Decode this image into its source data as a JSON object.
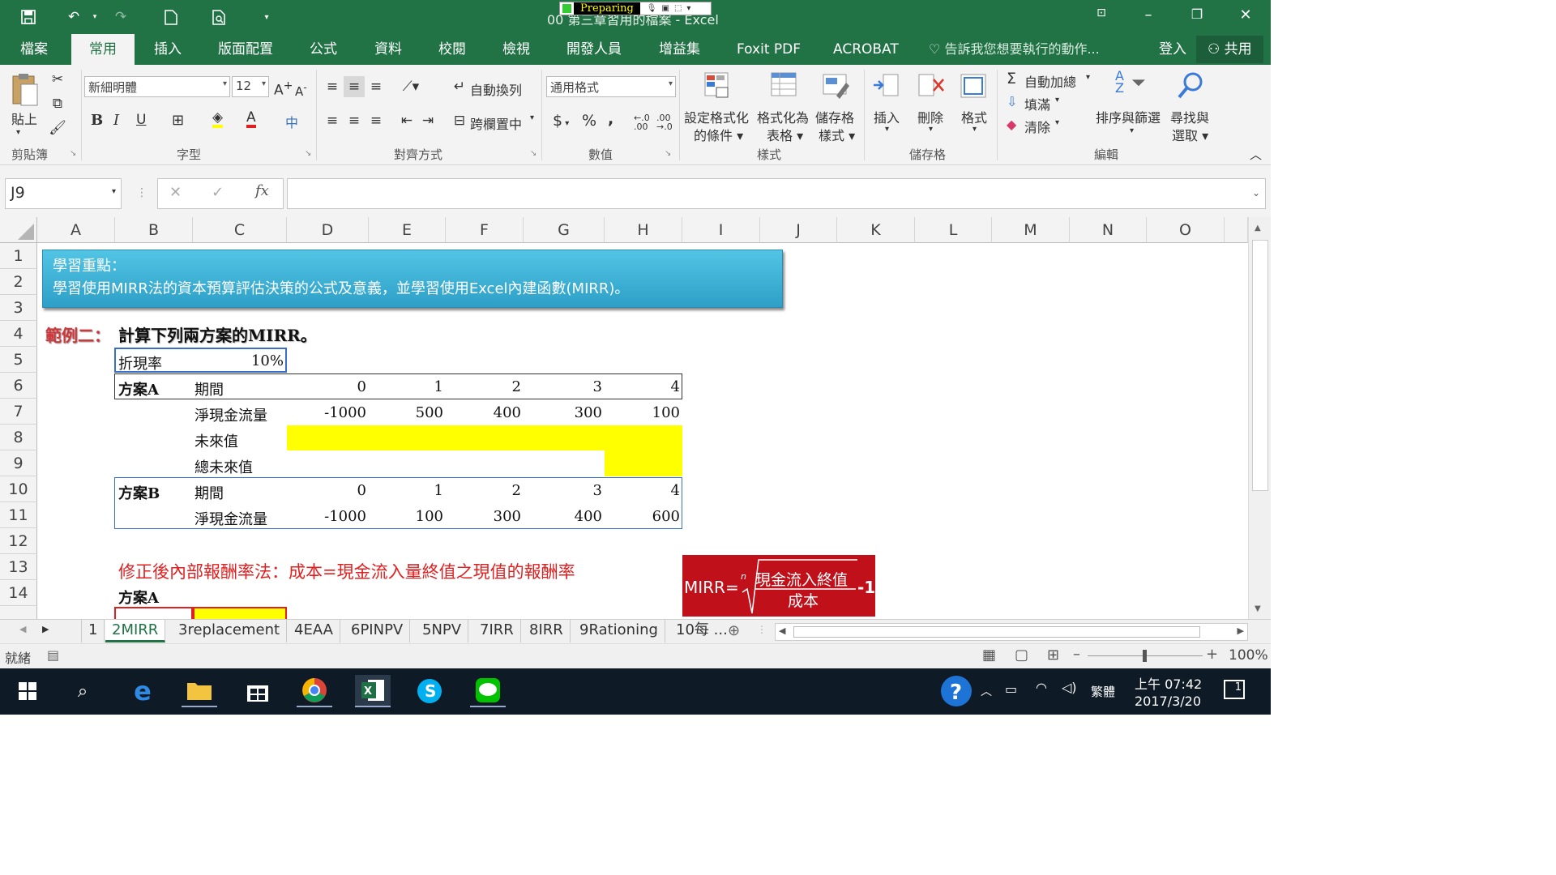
{
  "window": {
    "title": "00 第三章習用的檔案 - Excel",
    "recorder_label": "Preparing"
  },
  "tabs": [
    "檔案",
    "常用",
    "插入",
    "版面配置",
    "公式",
    "資料",
    "校閱",
    "檢視",
    "開發人員",
    "增益集",
    "Foxit PDF",
    "ACROBAT"
  ],
  "active_tab": "常用",
  "tell_me": "告訴我您想要執行的動作...",
  "signin": "登入",
  "share": "共用",
  "ribbon": {
    "clipboard": {
      "paste": "貼上",
      "label": "剪貼簿"
    },
    "font": {
      "name": "新細明體",
      "size": "12",
      "label": "字型"
    },
    "alignment": {
      "wrap": "自動換列",
      "merge": "跨欄置中",
      "label": "對齊方式"
    },
    "number": {
      "format": "通用格式",
      "label": "數值",
      "currency": "$",
      "percent": "%",
      "comma": ","
    },
    "styles": {
      "conditional": "設定格式化",
      "conditional2": "的條件",
      "table": "格式化為",
      "table2": "表格",
      "cell": "儲存格",
      "cell2": "樣式",
      "label": "樣式"
    },
    "cells": {
      "insert": "插入",
      "delete": "刪除",
      "format": "格式",
      "label": "儲存格"
    },
    "editing": {
      "autosum": "自動加總",
      "fill": "填滿",
      "clear": "清除",
      "sort": "排序與篩選",
      "find": "尋找與",
      "find2": "選取",
      "label": "編輯"
    }
  },
  "formula_bar": {
    "name_box": "J9",
    "fx": "fx",
    "value": ""
  },
  "columns": [
    "A",
    "B",
    "C",
    "D",
    "E",
    "F",
    "G",
    "H",
    "I",
    "J",
    "K",
    "L",
    "M",
    "N",
    "O"
  ],
  "rows": [
    "1",
    "2",
    "3",
    "4",
    "5",
    "6",
    "7",
    "8",
    "9",
    "10",
    "11",
    "12",
    "13",
    "14"
  ],
  "sheet": {
    "note_title": "學習重點：",
    "note_body": "學習使用MIRR法的資本預算評估決策的公式及意義，並學習使用Excel內建函數(MIRR)。",
    "example_label": "範例二：",
    "example_text": "計算下列兩方案的MIRR。",
    "discount_label": "折現率",
    "discount_value": "10%",
    "planA": {
      "name": "方案A",
      "period_label": "期間",
      "periods": [
        "0",
        "1",
        "2",
        "3",
        "4"
      ],
      "cf_label": "淨現金流量",
      "cf": [
        "-1000",
        "500",
        "400",
        "300",
        "100"
      ],
      "fv_label": "未來值",
      "tfv_label": "總未來值"
    },
    "planB": {
      "name": "方案B",
      "period_label": "期間",
      "periods": [
        "0",
        "1",
        "2",
        "3",
        "4"
      ],
      "cf_label": "淨現金流量",
      "cf": [
        "-1000",
        "100",
        "300",
        "400",
        "600"
      ]
    },
    "mirr_title": "修正後內部報酬率法：成本=現金流入量終值之現值的報酬率",
    "row14_label": "方案A",
    "formula_box": {
      "lhs": "MIRR=",
      "n": "n",
      "numerator": "現金流入終值",
      "denominator": "成本",
      "tail": "-1"
    }
  },
  "sheet_tabs": [
    "1",
    "2MIRR",
    "3replacement",
    "4EAA",
    "6PINPV",
    "5NPV",
    "7IRR",
    "8IRR",
    "9Rationing",
    "10每 ..."
  ],
  "active_sheet": "2MIRR",
  "status": {
    "ready": "就緒",
    "zoom": "100%"
  },
  "taskbar": {
    "time": "上午 07:42",
    "date": "2017/3/20",
    "ime": "繁體",
    "notifications": "1"
  },
  "colors": {
    "excel_green": "#217346",
    "note_blue": "#3bb0d4",
    "highlight": "#ffff00",
    "formula_red": "#c0101a",
    "text_red": "#e02020"
  }
}
